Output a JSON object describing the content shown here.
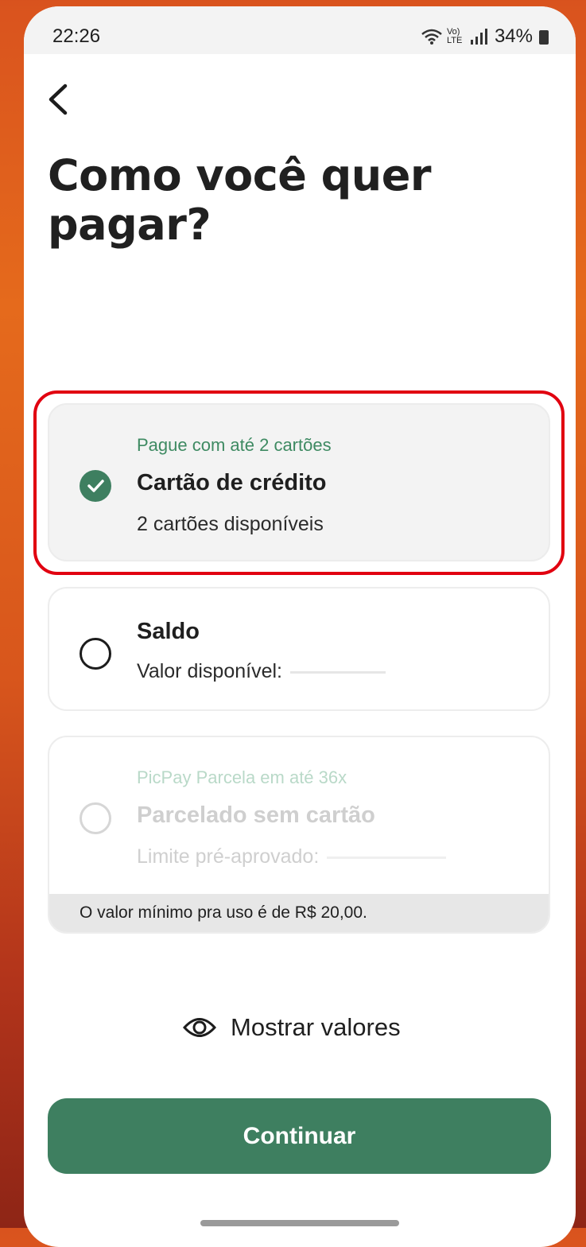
{
  "status_bar": {
    "time": "22:26",
    "battery": "34%",
    "volte_label": "Vo) LTE"
  },
  "header": {
    "title": "Como você quer pagar?"
  },
  "payment_options": [
    {
      "tag": "Pague com até 2 cartões",
      "label": "Cartão de crédito",
      "sub": "2 cartões disponíveis",
      "selected": true
    },
    {
      "tag": "",
      "label": "Saldo",
      "sub": "Valor disponível:",
      "selected": false
    },
    {
      "tag": "PicPay Parcela em até 36x",
      "label": "Parcelado sem cartão",
      "sub": "Limite pré-aprovado:",
      "selected": false,
      "disabled": true,
      "footnote": "O valor mínimo pra uso é de R$ 20,00."
    }
  ],
  "show_values": {
    "label": "Mostrar valores",
    "icon": "eye-icon"
  },
  "primary_action": {
    "label": "Continuar"
  },
  "colors": {
    "brand_green": "#3e7f60",
    "highlight_red": "#e10010"
  }
}
